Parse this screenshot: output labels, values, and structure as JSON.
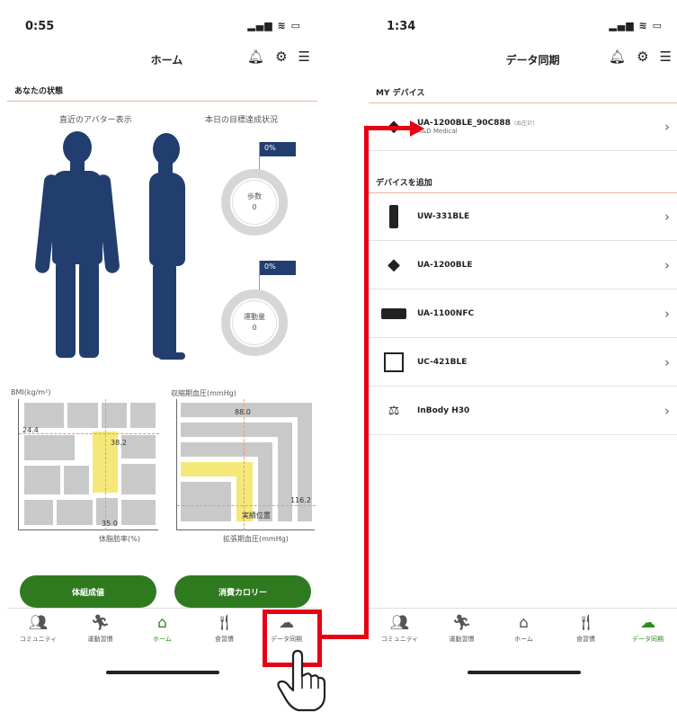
{
  "left": {
    "status": {
      "time": "0:55",
      "system": "▂▄▆ ≋ ▭"
    },
    "title": "ホーム",
    "section_title": "あなたの状態",
    "avatar_caption": "直近のアバター表示",
    "goal_caption": "本日の目標達成状況",
    "goals": [
      {
        "flag": "0%",
        "label": "歩数",
        "value": "0"
      },
      {
        "flag": "0%",
        "label": "運動量",
        "value": "0"
      }
    ],
    "bmi_chart": {
      "label": "BMI(kg/m²)",
      "y_value": "24.4",
      "x_value": "35.0",
      "marker": "38.2",
      "x_axis": "体脂肪率(%)"
    },
    "bp_chart": {
      "label": "収縮期血圧(mmHg)",
      "y_value": "88.0",
      "x_value": "116.2",
      "marker": "実績位置",
      "x_axis": "拡張期血圧(mmHg)"
    },
    "buttons": [
      "体組成値",
      "消費カロリー"
    ],
    "tabs": [
      {
        "label": "コミュニティ",
        "icon": "community-icon"
      },
      {
        "label": "運動習慣",
        "icon": "runner-icon"
      },
      {
        "label": "ホーム",
        "icon": "home-icon"
      },
      {
        "label": "食習慣",
        "icon": "meal-icon"
      },
      {
        "label": "データ同期",
        "icon": "cloud-upload-icon"
      }
    ]
  },
  "right": {
    "status": {
      "time": "1:34",
      "system": "▂▄▆ ≋ ▭"
    },
    "title": "データ同期",
    "my_devices_title": "MY デバイス",
    "my_device": {
      "name": "UA-1200BLE_90C888",
      "note": "(血圧計)",
      "maker": "A&D Medical"
    },
    "add_device_title": "デバイスを追加",
    "devices": [
      {
        "name": "UW-331BLE",
        "icon": "scale-device-icon"
      },
      {
        "name": "UA-1200BLE",
        "icon": "bp-monitor-icon"
      },
      {
        "name": "UA-1100NFC",
        "icon": "bp-cuff-icon"
      },
      {
        "name": "UC-421BLE",
        "icon": "body-scale-icon"
      },
      {
        "name": "InBody H30",
        "icon": "inbody-icon"
      }
    ],
    "tabs": [
      {
        "label": "コミュニティ",
        "icon": "community-icon"
      },
      {
        "label": "運動習慣",
        "icon": "runner-icon"
      },
      {
        "label": "ホーム",
        "icon": "home-icon"
      },
      {
        "label": "食習慣",
        "icon": "meal-icon"
      },
      {
        "label": "データ同期",
        "icon": "cloud-upload-icon"
      }
    ]
  },
  "colors": {
    "accent_green": "#2f7a1f",
    "figure_navy": "#223e6e",
    "annotation_red": "#e60012"
  }
}
